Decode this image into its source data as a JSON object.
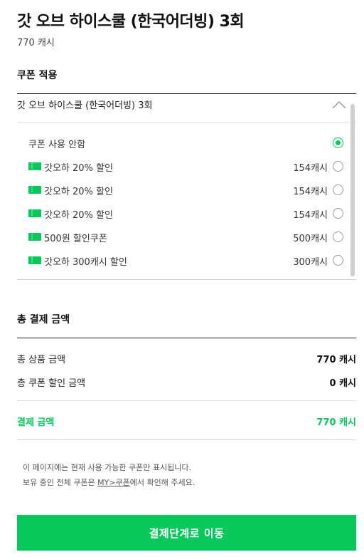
{
  "product": {
    "title": "갓 오브 하이스쿨 (한국어더빙) 3회",
    "price": "770 캐시"
  },
  "coupon_section": {
    "title": "쿠폰 적용",
    "selected_label": "갓 오브 하이스쿨 (한국어더빙) 3회",
    "items": [
      {
        "name": "쿠폰 사용 안함",
        "amount": "",
        "has_icon": false,
        "selected": true
      },
      {
        "name": "갓오하 20% 할인",
        "amount": "154캐시",
        "has_icon": true,
        "selected": false
      },
      {
        "name": "갓오하 20% 할인",
        "amount": "154캐시",
        "has_icon": true,
        "selected": false
      },
      {
        "name": "갓오하 20% 할인",
        "amount": "154캐시",
        "has_icon": true,
        "selected": false
      },
      {
        "name": "500원 할인쿠폰",
        "amount": "500캐시",
        "has_icon": true,
        "selected": false
      },
      {
        "name": "갓오하 300캐시 할인",
        "amount": "300캐시",
        "has_icon": true,
        "selected": false
      }
    ]
  },
  "total_section": {
    "title": "총 결제 금액",
    "product_amount_label": "총 상품 금액",
    "product_amount_value": "770 캐시",
    "coupon_discount_label": "총 쿠폰 할인 금액",
    "coupon_discount_value": "0 캐시",
    "pay_label": "결제 금액",
    "pay_value": "770 캐시"
  },
  "notice": {
    "line1": "이 페이지에는 현재 사용 가능한 쿠폰만 표시됩니다.",
    "line2_before": "보유 중인 전체 쿠폰은 ",
    "line2_link": "MY>쿠폰",
    "line2_after": "에서 확인해 주세요."
  },
  "checkout": {
    "label": "결제단계로 이동"
  },
  "colors": {
    "accent": "#07c85a",
    "border_dark": "#222222",
    "border_light": "#d4d4d4"
  },
  "icons": {
    "coupon": "ticket-icon",
    "collapse": "chevron-up-icon"
  }
}
